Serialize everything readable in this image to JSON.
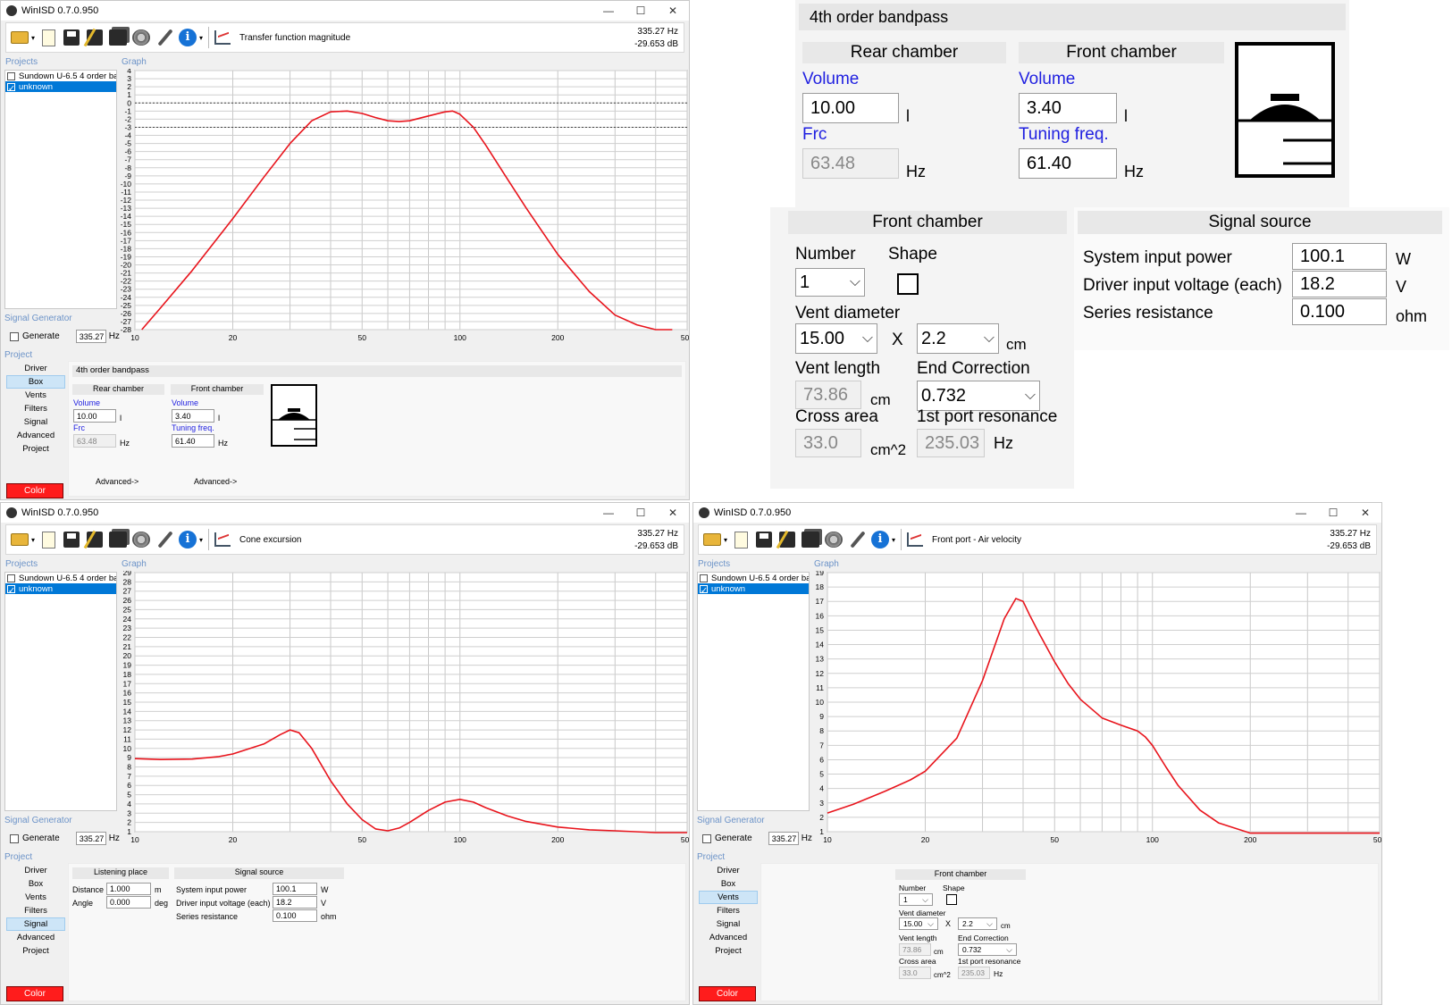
{
  "app": {
    "title": "WinISD 0.7.0.950",
    "win_minimize": "—",
    "win_maximize": "☐",
    "win_close": "✕"
  },
  "toolbar": {
    "icons": [
      "open-folder-icon",
      "new-project-icon",
      "save-icon",
      "save-as-icon",
      "save-all-icon",
      "driver-speaker-icon",
      "settings-wrench-icon",
      "info-icon",
      "graph-type-icon"
    ],
    "freq_readout": "335.27 Hz",
    "db_readout": "-29.653 dB"
  },
  "sections": {
    "projects": "Projects",
    "graph": "Graph",
    "signal_generator": "Signal Generator",
    "project": "Project"
  },
  "projects": [
    {
      "name": "Sundown U-6.5 4 order ban",
      "checked": false,
      "selected": false
    },
    {
      "name": "unknown",
      "checked": true,
      "selected": true
    }
  ],
  "signal_generator": {
    "generate_label": "Generate",
    "value": "335.27",
    "unit": "Hz"
  },
  "nav": {
    "items": [
      "Driver",
      "Box",
      "Vents",
      "Filters",
      "Signal",
      "Advanced",
      "Project"
    ],
    "color_button": "Color"
  },
  "windows": [
    {
      "graph_title": "Transfer function magnitude",
      "active_nav": "Box"
    },
    {
      "graph_title": "Cone excursion",
      "active_nav": "Signal"
    },
    {
      "graph_title": "Front port - Air velocity",
      "active_nav": "Vents"
    }
  ],
  "box": {
    "header": "4th order bandpass",
    "rear_title": "Rear chamber",
    "front_title": "Front chamber",
    "volume_label": "Volume",
    "rear_volume": "10.00",
    "front_volume": "3.40",
    "volume_unit": "l",
    "frc_label": "Frc",
    "frc_value": "63.48",
    "frc_unit": "Hz",
    "tuning_label": "Tuning freq.",
    "tuning_value": "61.40",
    "tuning_unit": "Hz",
    "advanced_link": "Advanced->"
  },
  "vents": {
    "title": "Front chamber",
    "number_label": "Number",
    "number_value": "1",
    "shape_label": "Shape",
    "diameter_label": "Vent diameter",
    "diameter_value": "15.00",
    "x_label": "X",
    "count_value": "2.2",
    "diameter_unit": "cm",
    "length_label": "Vent length",
    "length_value": "73.86",
    "length_unit": "cm",
    "end_corr_label": "End Correction",
    "end_corr_value": "0.732",
    "area_label": "Cross area",
    "area_value": "33.0",
    "area_unit": "cm^2",
    "resonance_label": "1st port resonance",
    "resonance_value": "235.03",
    "resonance_unit": "Hz"
  },
  "listening": {
    "title": "Listening place",
    "distance_label": "Distance",
    "distance_value": "1.000",
    "distance_unit": "m",
    "angle_label": "Angle",
    "angle_value": "0.000",
    "angle_unit": "deg"
  },
  "signal": {
    "title": "Signal source",
    "power_label": "System input power",
    "power_value": "100.1",
    "power_unit": "W",
    "voltage_label": "Driver input voltage (each)",
    "voltage_value": "18.2",
    "voltage_unit": "V",
    "resistance_label": "Series resistance",
    "resistance_value": "0.100",
    "resistance_unit": "ohm"
  },
  "chart_data": [
    {
      "type": "line",
      "title": "Transfer function magnitude",
      "x_scale": "log",
      "x_ticks": [
        "10",
        "20",
        "50",
        "100",
        "200",
        "500"
      ],
      "xlim": [
        10,
        500
      ],
      "ylim": [
        -28,
        4
      ],
      "y_ticks": [
        "4",
        "3",
        "2",
        "1",
        "0",
        "-1",
        "-2",
        "-3",
        "-4",
        "-5",
        "-6",
        "-7",
        "-8",
        "-9",
        "-10",
        "-11",
        "-12",
        "-13",
        "-14",
        "-15",
        "-16",
        "-17",
        "-18",
        "-19",
        "-20",
        "-21",
        "-22",
        "-23",
        "-24",
        "-25",
        "-26",
        "-27",
        "-28"
      ],
      "reference_lines": [
        0,
        -3
      ],
      "color": "#e8141c",
      "series": [
        {
          "x": [
            10.5,
            12,
            15,
            20,
            25,
            30,
            35,
            40,
            45,
            50,
            55,
            60,
            65,
            70,
            80,
            90,
            95,
            100,
            110,
            120,
            140,
            160,
            200,
            250,
            300,
            350,
            400,
            450
          ],
          "y": [
            -28,
            -25.3,
            -20.7,
            -14.3,
            -9.1,
            -5.0,
            -2.2,
            -1.1,
            -1.0,
            -1.3,
            -1.8,
            -2.2,
            -2.3,
            -2.2,
            -1.6,
            -1.1,
            -1.0,
            -1.4,
            -3.0,
            -5.2,
            -9.4,
            -13.0,
            -18.7,
            -23.3,
            -26.2,
            -27.4,
            -28,
            -28
          ]
        }
      ]
    },
    {
      "type": "line",
      "title": "Cone excursion",
      "x_scale": "log",
      "x_ticks": [
        "10",
        "20",
        "50",
        "100",
        "200",
        "500"
      ],
      "xlim": [
        10,
        500
      ],
      "ylim": [
        1,
        29
      ],
      "y_ticks": [
        "29",
        "28",
        "27",
        "26",
        "25",
        "24",
        "23",
        "22",
        "21",
        "20",
        "19",
        "18",
        "17",
        "16",
        "15",
        "14",
        "13",
        "12",
        "11",
        "10",
        "9",
        "8",
        "7",
        "6",
        "5",
        "4",
        "3",
        "2",
        "1"
      ],
      "color": "#e8141c",
      "series": [
        {
          "x": [
            10,
            12,
            15,
            18,
            20,
            25,
            28,
            30,
            32,
            35,
            40,
            45,
            50,
            55,
            60,
            65,
            70,
            80,
            90,
            100,
            110,
            120,
            140,
            160,
            200,
            250,
            300,
            400,
            500
          ],
          "y": [
            8.9,
            8.8,
            8.85,
            9.1,
            9.4,
            10.5,
            11.5,
            12.0,
            11.7,
            10.0,
            6.5,
            4.0,
            2.3,
            1.3,
            1.1,
            1.4,
            2.0,
            3.3,
            4.2,
            4.5,
            4.2,
            3.6,
            2.7,
            2.1,
            1.5,
            1.2,
            1.1,
            0.9,
            0.8
          ]
        }
      ]
    },
    {
      "type": "line",
      "title": "Front port - Air velocity",
      "x_scale": "log",
      "x_ticks": [
        "10",
        "20",
        "50",
        "100",
        "200",
        "500"
      ],
      "xlim": [
        10,
        500
      ],
      "ylim": [
        1,
        19
      ],
      "y_ticks": [
        "19",
        "18",
        "17",
        "16",
        "15",
        "14",
        "13",
        "12",
        "11",
        "10",
        "9",
        "8",
        "7",
        "6",
        "5",
        "4",
        "3",
        "2",
        "1"
      ],
      "color": "#e8141c",
      "series": [
        {
          "x": [
            10,
            12,
            15,
            18,
            20,
            25,
            30,
            35,
            38,
            40,
            42,
            45,
            50,
            55,
            60,
            70,
            80,
            90,
            95,
            100,
            110,
            120,
            140,
            160,
            200,
            250,
            300,
            400,
            500
          ],
          "y": [
            2.3,
            2.9,
            3.8,
            4.6,
            5.2,
            7.5,
            11.5,
            15.8,
            17.2,
            17.0,
            16.0,
            14.7,
            12.8,
            11.3,
            10.2,
            8.9,
            8.4,
            8.0,
            7.6,
            7.0,
            5.5,
            4.2,
            2.5,
            1.6,
            0.8,
            0.4,
            0.25,
            0.15,
            0.1
          ]
        }
      ]
    }
  ]
}
